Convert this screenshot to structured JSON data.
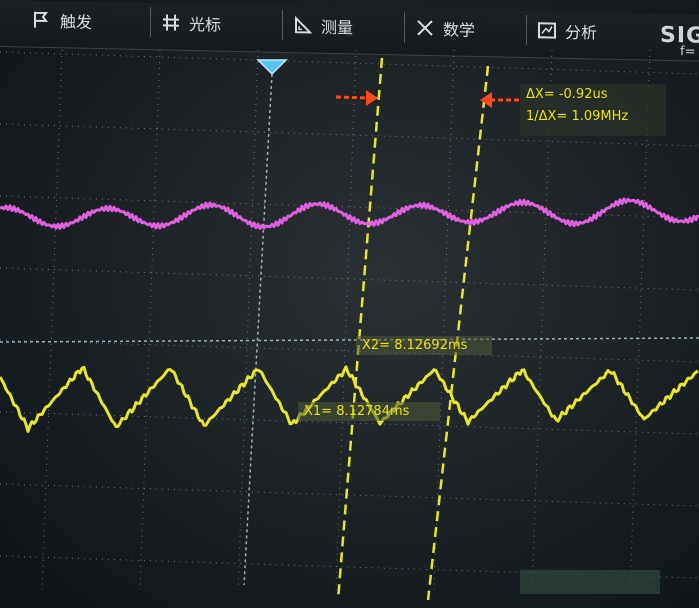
{
  "menu": {
    "items": [
      {
        "label": "触发",
        "icon": "flag-icon"
      },
      {
        "label": "光标",
        "icon": "cursor-icon"
      },
      {
        "label": "测量",
        "icon": "ruler-icon"
      },
      {
        "label": "数学",
        "icon": "math-icon"
      },
      {
        "label": "分析",
        "icon": "analysis-icon"
      }
    ],
    "brand": "SIG",
    "brand_sub": "f="
  },
  "cursors": {
    "delta_x": "ΔX= -0.92us",
    "inv_delta_x": "1/ΔX= 1.09MHz",
    "x1": "X1= 8.12784ms",
    "x2": "X2= 8.12692ms"
  },
  "bottom_tab": "",
  "colors": {
    "ch1": "#e6e62a",
    "ch2": "#e060e0",
    "cursor": "#e6e62a",
    "arrow": "#ff4a1a",
    "trigger": "#56c4f0",
    "grid": "#8fa2ad"
  }
}
